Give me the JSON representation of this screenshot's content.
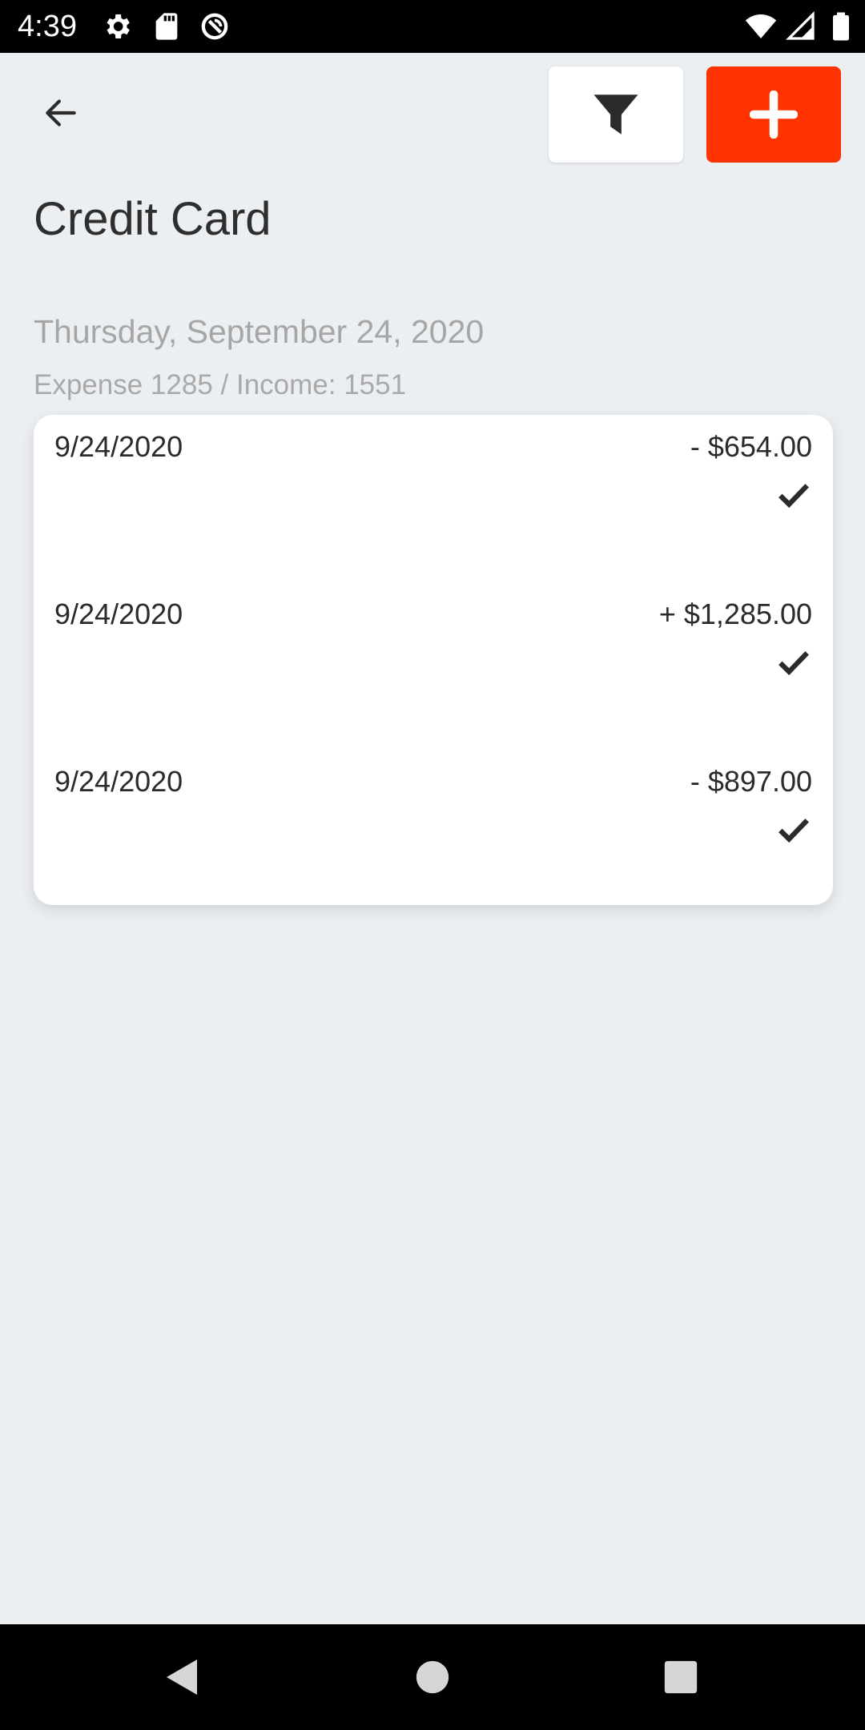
{
  "status_bar": {
    "time": "4:39",
    "icons": [
      "settings-icon",
      "sd-card-icon",
      "sync-icon",
      "wifi-icon",
      "signal-icon",
      "battery-icon"
    ]
  },
  "header": {
    "back_icon": "arrow-back-icon",
    "filter_icon": "filter-icon",
    "add_icon": "plus-icon",
    "add_button_color": "#ff3300"
  },
  "page": {
    "title": "Credit Card"
  },
  "section": {
    "date": "Thursday, September 24, 2020",
    "summary": "Expense 1285 / Income: 1551"
  },
  "transactions": [
    {
      "date": "9/24/2020",
      "amount": "- $654.00",
      "status_icon": "check-icon"
    },
    {
      "date": "9/24/2020",
      "amount": "+ $1,285.00",
      "status_icon": "check-icon"
    },
    {
      "date": "9/24/2020",
      "amount": "- $897.00",
      "status_icon": "check-icon"
    }
  ],
  "nav_bar": {
    "icons": [
      "back-triangle-icon",
      "home-circle-icon",
      "recents-square-icon"
    ]
  },
  "colors": {
    "background": "#eceff2",
    "accent": "#ff3300",
    "muted_text": "#a6a6a6"
  }
}
